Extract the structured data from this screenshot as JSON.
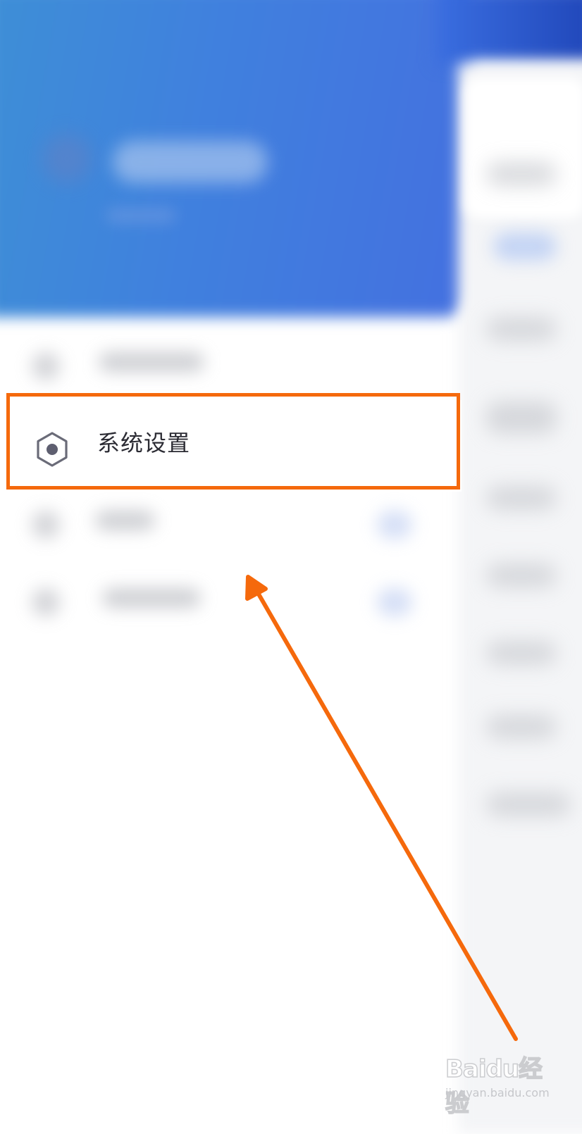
{
  "menu": {
    "settings_label": "系统设置"
  },
  "annotation": {
    "highlight_color": "#f5690c",
    "arrow_color": "#f5690c"
  },
  "colors": {
    "header_blue": "#4080de",
    "background": "#ffffff",
    "text": "#2b2b33"
  },
  "icons": {
    "settings": "hexagon-gear-icon"
  },
  "watermark": {
    "logo": "Baidu经验",
    "url": "jingyan.baidu.com"
  }
}
